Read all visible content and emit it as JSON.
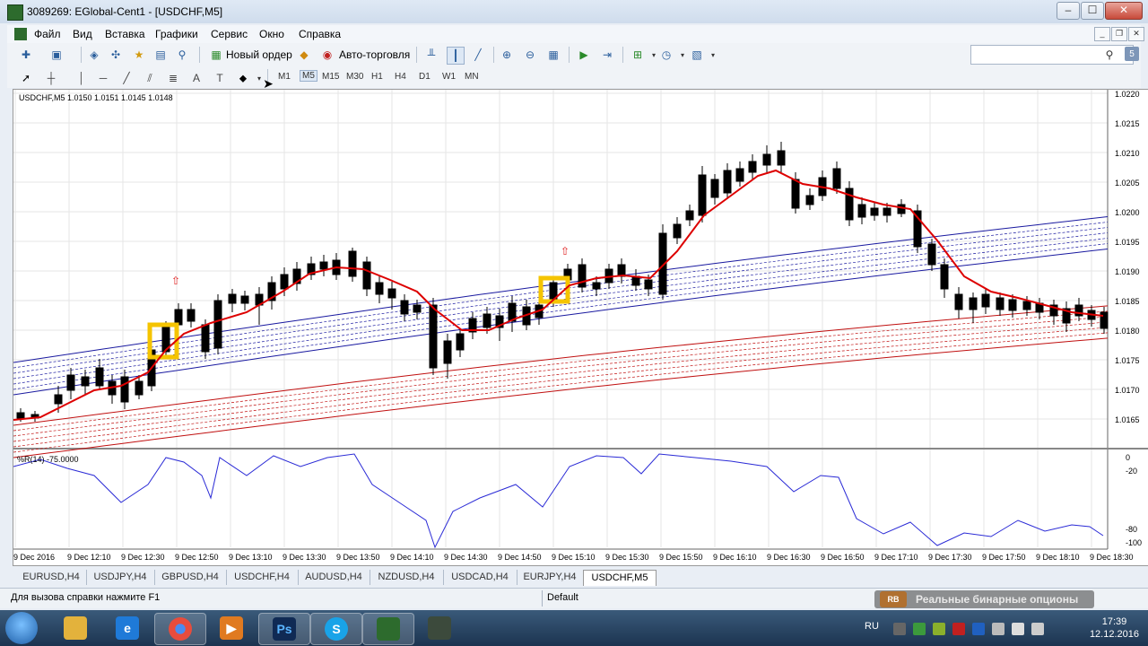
{
  "window": {
    "title": "3089269: EGlobal-Cent1 - [USDCHF,M5]",
    "min_label": "‒",
    "max_label": "☐",
    "close_label": "✕"
  },
  "menu": {
    "items": [
      "Файл",
      "Вид",
      "Вставка",
      "Графики",
      "Сервис",
      "Окно",
      "Справка"
    ]
  },
  "toolbar": {
    "new_order": "Новый ордер",
    "auto_trading": "Авто-торговля",
    "search_placeholder": ""
  },
  "timeframes": [
    "M1",
    "M5",
    "M15",
    "M30",
    "H1",
    "H4",
    "D1",
    "W1",
    "MN"
  ],
  "active_timeframe": "M5",
  "chart": {
    "header": "USDCHF,M5  1.0150 1.0151 1.0145 1.0148",
    "indicator_label": "%R(14) -75.0000",
    "price_ticks": [
      "1.0220",
      "1.0215",
      "1.0210",
      "1.0205",
      "1.0200",
      "1.0195",
      "1.0190",
      "1.0185",
      "1.0180",
      "1.0175",
      "1.0170",
      "1.0165"
    ],
    "indicator_ticks": [
      "0",
      "-20",
      "-80",
      "-100"
    ],
    "time_ticks": [
      "9 Dec 2016",
      "9 Dec 12:10",
      "9 Dec 12:30",
      "9 Dec 12:50",
      "9 Dec 13:10",
      "9 Dec 13:30",
      "9 Dec 13:50",
      "9 Dec 14:10",
      "9 Dec 14:30",
      "9 Dec 14:50",
      "9 Dec 15:10",
      "9 Dec 15:30",
      "9 Dec 15:50",
      "9 Dec 16:10",
      "9 Dec 16:30",
      "9 Dec 16:50",
      "9 Dec 17:10",
      "9 Dec 17:30",
      "9 Dec 17:50",
      "9 Dec 18:10",
      "9 Dec 18:30"
    ]
  },
  "tabs": [
    "EURUSD,H4",
    "USDJPY,H4",
    "GBPUSD,H4",
    "USDCHF,H4",
    "AUDUSD,H4",
    "NZDUSD,H4",
    "USDCAD,H4",
    "EURJPY,H4",
    "USDCHF,M5"
  ],
  "active_tab": "USDCHF,M5",
  "status": {
    "hint": "Для вызова справки нажмите F1",
    "profile": "Default",
    "watermark": "Реальные бинарные опционы",
    "watermark_logo": "RB"
  },
  "taskbar": {
    "lang": "RU",
    "time": "17:39",
    "date": "12.12.2016"
  },
  "colors": {
    "bull": "#ffffff",
    "bear": "#000000",
    "ma": "#dd0000",
    "blue_band": "#1a1aa0",
    "red_band": "#c01010",
    "wpr_line": "#2b2bd6",
    "highlight": "#f5c400"
  }
}
